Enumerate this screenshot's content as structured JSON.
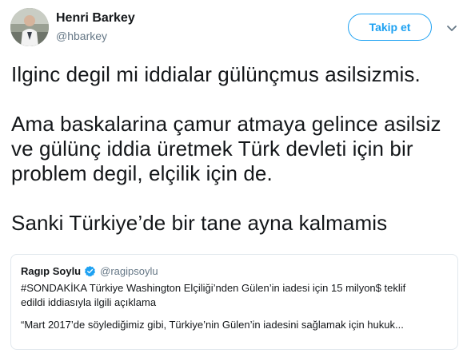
{
  "author": {
    "name": "Henri Barkey",
    "handle": "@hbarkey"
  },
  "follow_button_label": "Takip et",
  "tweet": {
    "paragraphs": [
      "Ilginc degil mi iddialar gülünçmus asilsizmis.",
      "Ama baskalarina çamur atmaya gelince asilsiz\nve gülünç iddia üretmek Türk devleti için bir\nproblem degil, elçilik için de.",
      "Sanki Türkiye’de bir tane ayna kalmamis"
    ]
  },
  "quoted_tweet": {
    "name": "Ragıp Soylu",
    "handle": "@ragipsoylu",
    "text": "#SONDAKİKA Türkiye Washington Elçiliği’nden Gülen’in iadesi için 15 milyon$ teklif\nedildi iddiasıyla ilgili  açıklama",
    "text_continued": "“Mart 2017’de söylediğimiz gibi, Türkiye’nin Gülen’in iadesini sağlamak için hukuk..."
  },
  "colors": {
    "accent": "#1da1f2",
    "secondary_text": "#657786",
    "border": "#e1e8ed"
  },
  "icons": {
    "caret": "chevron-down-icon",
    "verified": "verified-badge-icon"
  }
}
